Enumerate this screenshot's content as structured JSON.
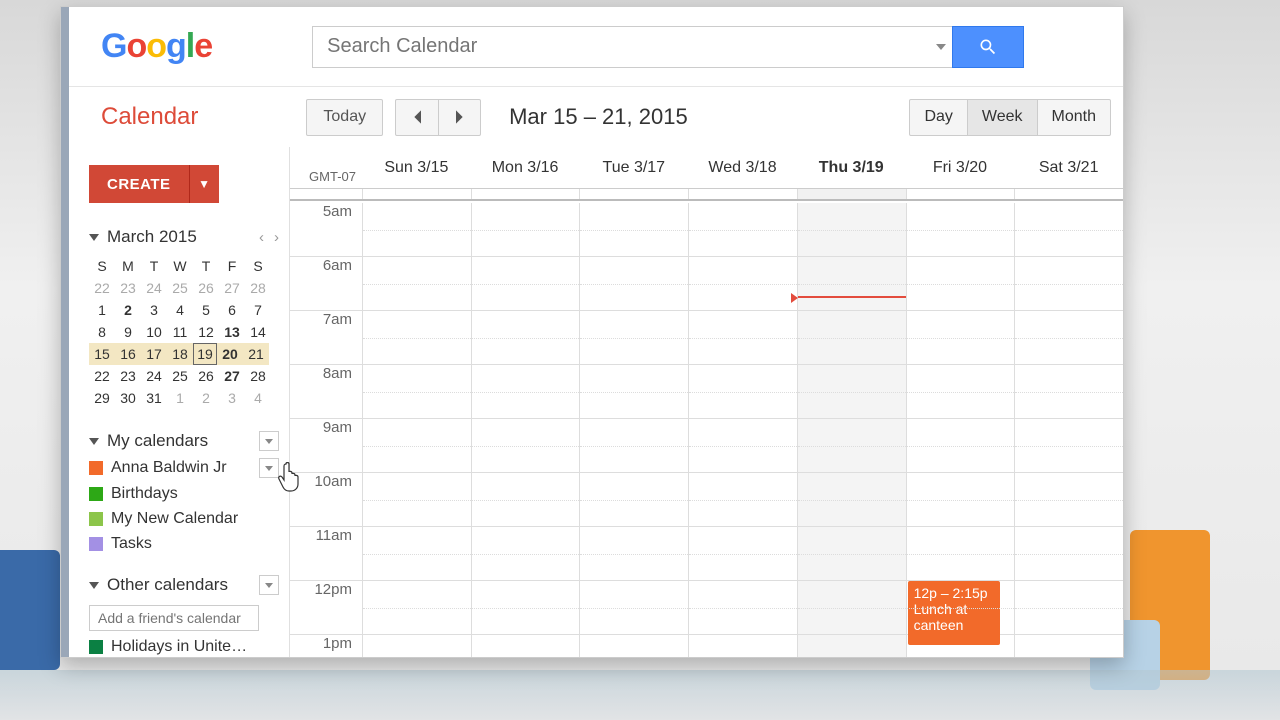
{
  "logo_letters": [
    "G",
    "o",
    "o",
    "g",
    "l",
    "e"
  ],
  "search": {
    "placeholder": "Search Calendar"
  },
  "app_title": "Calendar",
  "toolbar": {
    "today": "Today",
    "date_range": "Mar 15 – 21, 2015",
    "views": {
      "day": "Day",
      "week": "Week",
      "month": "Month"
    }
  },
  "create": {
    "label": "CREATE",
    "dropdown": "▼"
  },
  "mini": {
    "month": "March 2015",
    "dow": [
      "S",
      "M",
      "T",
      "W",
      "T",
      "F",
      "S"
    ],
    "rows": [
      [
        {
          "n": "22",
          "dim": true
        },
        {
          "n": "23",
          "dim": true
        },
        {
          "n": "24",
          "dim": true
        },
        {
          "n": "25",
          "dim": true
        },
        {
          "n": "26",
          "dim": true
        },
        {
          "n": "27",
          "dim": true
        },
        {
          "n": "28",
          "dim": true
        }
      ],
      [
        {
          "n": "1"
        },
        {
          "n": "2",
          "bold": true
        },
        {
          "n": "3"
        },
        {
          "n": "4"
        },
        {
          "n": "5"
        },
        {
          "n": "6"
        },
        {
          "n": "7"
        }
      ],
      [
        {
          "n": "8"
        },
        {
          "n": "9"
        },
        {
          "n": "10"
        },
        {
          "n": "11"
        },
        {
          "n": "12"
        },
        {
          "n": "13",
          "bold": true
        },
        {
          "n": "14"
        }
      ],
      [
        {
          "n": "15",
          "hl": true
        },
        {
          "n": "16",
          "hl": true
        },
        {
          "n": "17",
          "hl": true
        },
        {
          "n": "18",
          "hl": true
        },
        {
          "n": "19",
          "hl": true,
          "today": true
        },
        {
          "n": "20",
          "hl": true,
          "bold": true
        },
        {
          "n": "21",
          "hl": true
        }
      ],
      [
        {
          "n": "22"
        },
        {
          "n": "23"
        },
        {
          "n": "24"
        },
        {
          "n": "25"
        },
        {
          "n": "26"
        },
        {
          "n": "27",
          "bold": true
        },
        {
          "n": "28"
        }
      ],
      [
        {
          "n": "29"
        },
        {
          "n": "30"
        },
        {
          "n": "31"
        },
        {
          "n": "1",
          "dim": true
        },
        {
          "n": "2",
          "dim": true
        },
        {
          "n": "3",
          "dim": true
        },
        {
          "n": "4",
          "dim": true
        }
      ]
    ]
  },
  "sections": {
    "my_calendars": {
      "title": "My calendars",
      "items": [
        {
          "name": "Anna Baldwin Jr",
          "color": "#f26a2a",
          "dropdown": true
        },
        {
          "name": "Birthdays",
          "color": "#2da816"
        },
        {
          "name": "My New Calendar",
          "color": "#8cc54a"
        },
        {
          "name": "Tasks",
          "color": "#a390e4"
        }
      ]
    },
    "other_calendars": {
      "title": "Other calendars",
      "add_placeholder": "Add a friend's calendar",
      "items": [
        {
          "name": "Holidays in United St…",
          "color": "#0b8043"
        }
      ]
    }
  },
  "grid": {
    "tz": "GMT-07",
    "days": [
      {
        "label": "Sun 3/15"
      },
      {
        "label": "Mon 3/16"
      },
      {
        "label": "Tue 3/17"
      },
      {
        "label": "Wed 3/18"
      },
      {
        "label": "Thu 3/19",
        "today": true
      },
      {
        "label": "Fri 3/20"
      },
      {
        "label": "Sat 3/21"
      }
    ],
    "hours": [
      "5am",
      "6am",
      "7am",
      "8am",
      "9am",
      "10am",
      "11am",
      "12pm",
      "1pm"
    ],
    "now_hour_index": 1,
    "now_fraction": 0.72
  },
  "event": {
    "time": "12p – 2:15p",
    "title": "Lunch at canteen",
    "day_index": 5,
    "start_hour_index": 7,
    "color": "#f26a2a"
  }
}
